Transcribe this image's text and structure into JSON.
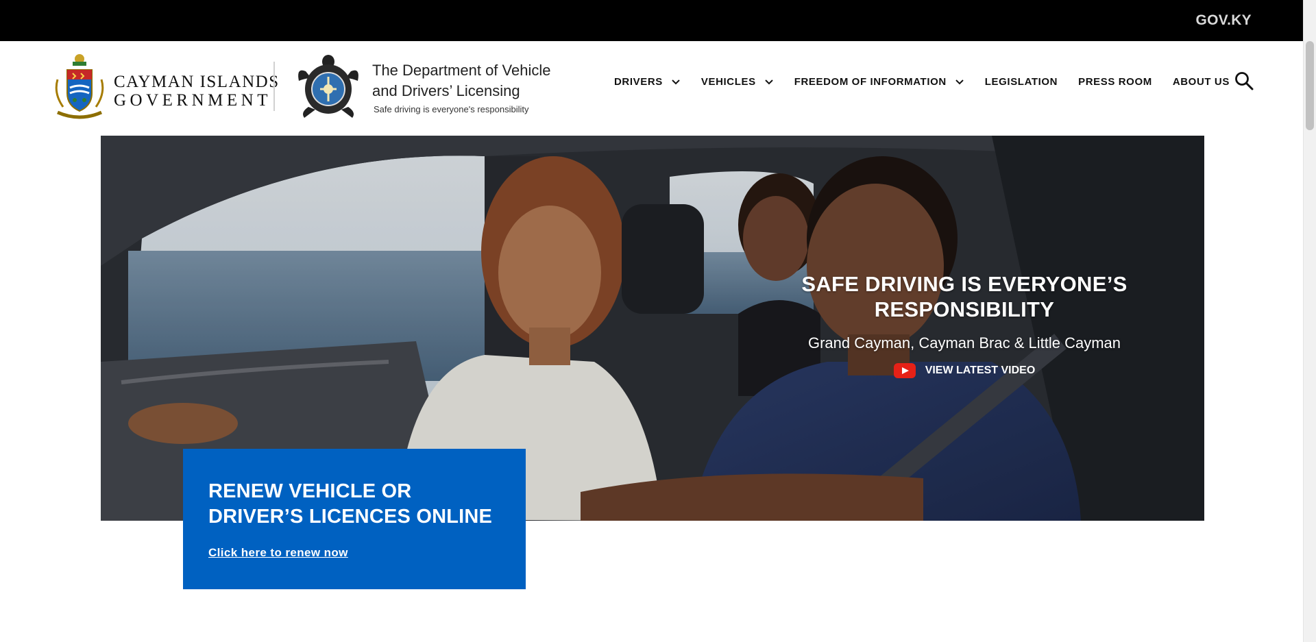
{
  "topbar": {
    "gov_link": "GOV.KY"
  },
  "header": {
    "government_name_line1": "CAYMAN ISLANDS",
    "government_name_line2": "GOVERNMENT",
    "department_title_line1": "The Department of Vehicle",
    "department_title_line2": "and Drivers’ Licensing",
    "department_tagline": "Safe driving is everyone's responsibility"
  },
  "nav": {
    "items": [
      {
        "label": "DRIVERS",
        "has_dropdown": true
      },
      {
        "label": "VEHICLES",
        "has_dropdown": true
      },
      {
        "label": "FREEDOM OF INFORMATION",
        "has_dropdown": true
      },
      {
        "label": "LEGISLATION",
        "has_dropdown": false
      },
      {
        "label": "PRESS ROOM",
        "has_dropdown": false
      },
      {
        "label": "ABOUT US",
        "has_dropdown": false
      }
    ],
    "search_icon": "search-icon"
  },
  "hero": {
    "heading_line1": "SAFE DRIVING IS EVERYONE’S",
    "heading_line2": "RESPONSIBILITY",
    "subheading": "Grand Cayman, Cayman Brac & Little Cayman",
    "video_link": "VIEW LATEST VIDEO",
    "video_icon": "youtube-play-icon"
  },
  "renew": {
    "title_line1": "RENEW VEHICLE OR",
    "title_line2": "DRIVER’S LICENCES ONLINE",
    "link": "Click here to renew now"
  },
  "colors": {
    "topbar": "#000000",
    "renew_box": "#0061c1",
    "youtube_red": "#e62117"
  }
}
